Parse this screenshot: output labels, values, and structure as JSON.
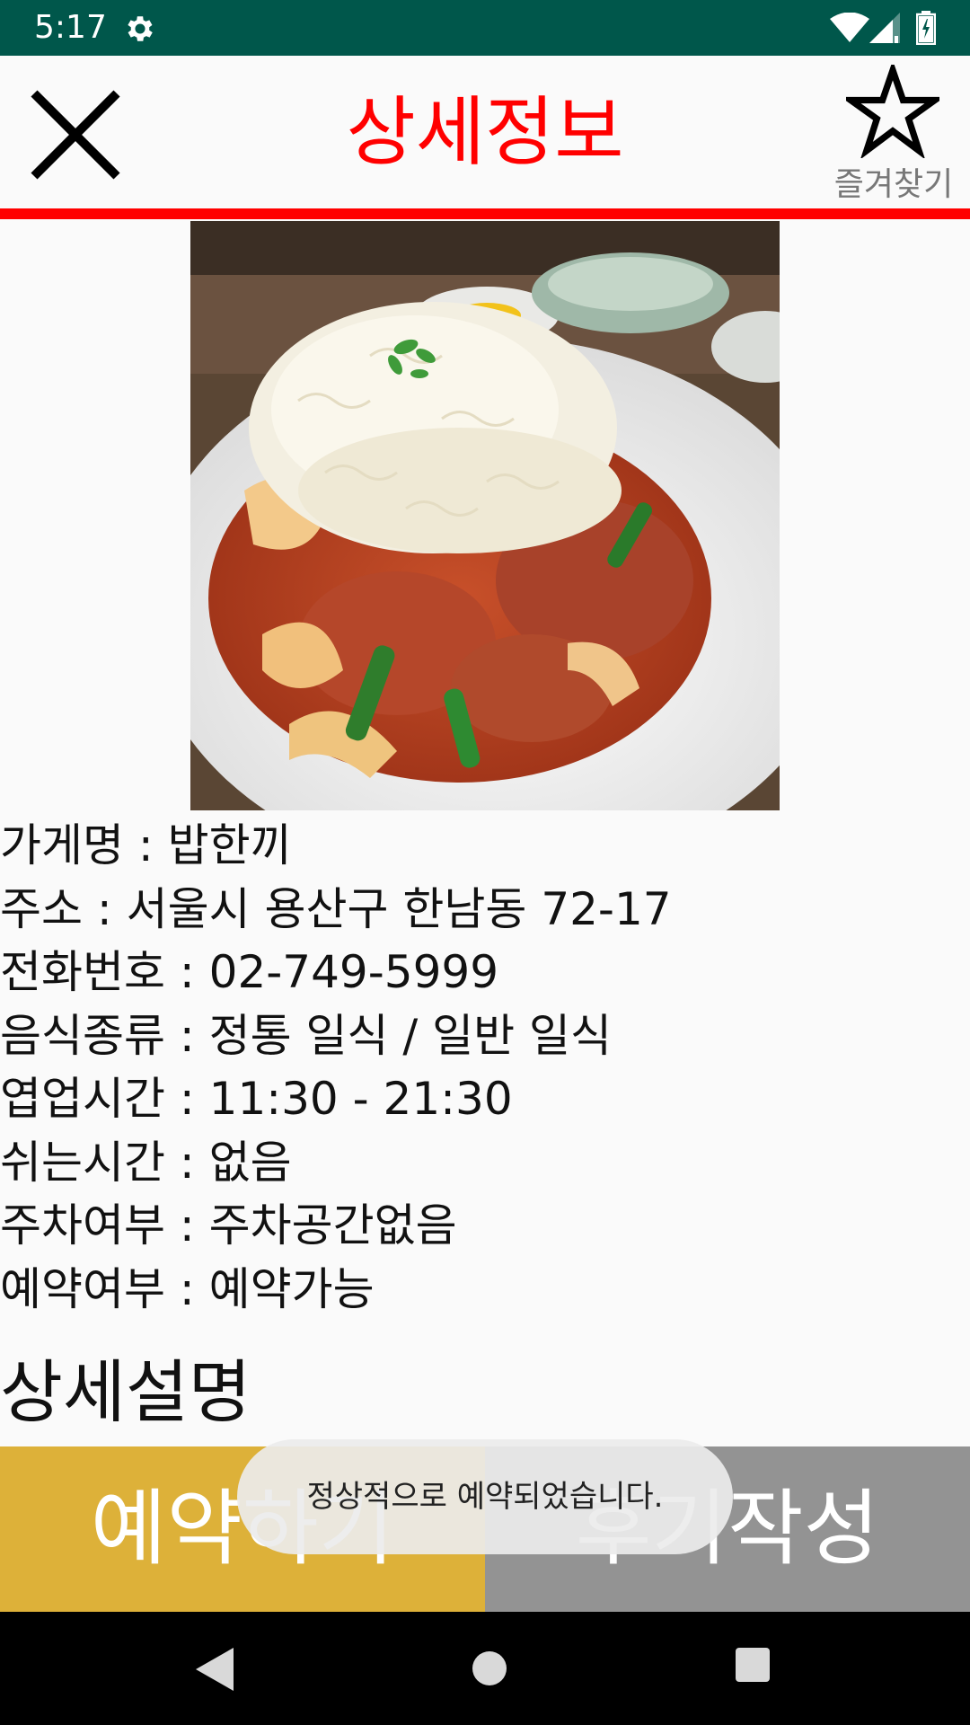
{
  "status_bar": {
    "time": "5:17",
    "background": "#00574b",
    "icons": [
      "gear-icon",
      "wifi-icon",
      "signal-icon",
      "battery-icon"
    ]
  },
  "header": {
    "title": "상세정보",
    "title_color": "#ff0000",
    "close_icon": "close-icon",
    "favorite_label": "즐겨찾기",
    "favorite_icon": "star-outline-icon",
    "divider_color": "#ff0000"
  },
  "store": {
    "image_alt": "cheese-topped spicy stir-fried pork dish",
    "info": [
      "가게명 : 밥한끼",
      "주소 : 서울시 용산구 한남동 72-17",
      "전화번호 : 02-749-5999",
      "음식종류 : 정통 일식 / 일반 일식",
      "엽업시간 : 11:30 - 21:30",
      "쉬는시간 : 없음",
      "주차여부 : 주차공간없음",
      "예약여부 : 예약가능"
    ]
  },
  "detail_section": {
    "title": "상세설명"
  },
  "actions": {
    "reserve_label": "예약하기",
    "reserve_color": "#ddb139",
    "review_label": "후기작성",
    "review_color": "#939393"
  },
  "toast": {
    "message": "정상적으로 예약되었습니다."
  },
  "nav_bar": {
    "icons": [
      "back-icon",
      "home-icon",
      "recents-icon"
    ]
  }
}
